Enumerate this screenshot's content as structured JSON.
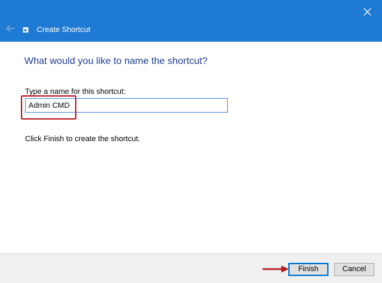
{
  "window": {
    "title": "Create Shortcut"
  },
  "icons": {
    "back": "back-arrow-icon",
    "close": "close-icon",
    "shortcut": "shortcut-icon"
  },
  "main": {
    "heading": "What would you like to name the shortcut?",
    "name_label": "Type a name for this shortcut:",
    "name_value": "Admin CMD",
    "instruction": "Click Finish to create the shortcut."
  },
  "footer": {
    "finish_label": "Finish",
    "cancel_label": "Cancel"
  },
  "colors": {
    "titlebar": "#1f7ad3",
    "heading": "#1e3d8f",
    "highlight": "#c0272d",
    "annotation_arrow": "#b01e23"
  }
}
